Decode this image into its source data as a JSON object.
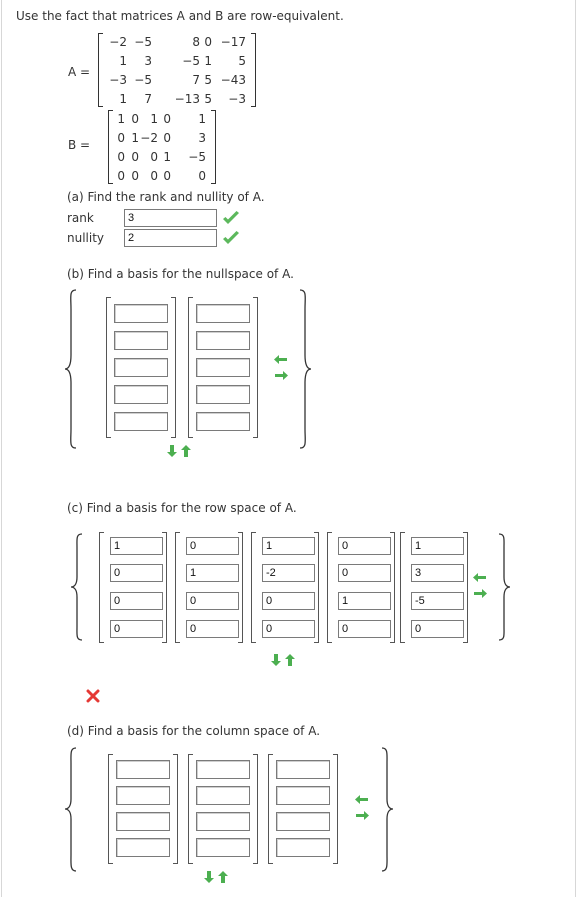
{
  "prompt": "Use the fact that matrices A and B are row-equivalent.",
  "matrixA": {
    "label": "A =",
    "rows": [
      [
        "−2",
        "−5",
        "8",
        "0",
        "−17"
      ],
      [
        "1",
        "3",
        "−5",
        "1",
        "5"
      ],
      [
        "−3",
        "−5",
        "7",
        "5",
        "−43"
      ],
      [
        "1",
        "7",
        "−13",
        "5",
        "−3"
      ]
    ]
  },
  "matrixB": {
    "label": "B =",
    "rows": [
      [
        "1",
        "0",
        "1",
        "0",
        "1"
      ],
      [
        "0",
        "1",
        "−2",
        "0",
        "3"
      ],
      [
        "0",
        "0",
        "0",
        "1",
        "−5"
      ],
      [
        "0",
        "0",
        "0",
        "0",
        "0"
      ]
    ]
  },
  "partA": {
    "title": "(a) Find the rank and nullity of A.",
    "rank_label": "rank",
    "rank_value": "3",
    "nullity_label": "nullity",
    "nullity_value": "2",
    "status_color": "#5cb85c"
  },
  "partB": {
    "title": "(b) Find a basis for the nullspace of A."
  },
  "partC": {
    "title": "(c) Find a basis for the row space of A.",
    "vectors": [
      [
        "1",
        "0",
        "0",
        "0"
      ],
      [
        "0",
        "1",
        "0",
        "0"
      ],
      [
        "1",
        "-2",
        "0",
        "0"
      ],
      [
        "0",
        "0",
        "1",
        "0"
      ],
      [
        "1",
        "3",
        "-5",
        "0"
      ]
    ],
    "status_color": "#e53935"
  },
  "partD": {
    "title": "(d) Find a basis for the column space of A."
  },
  "icons": {
    "arrow_color": "#4caf50",
    "add_remove_column": "add-remove-column-icon",
    "add_remove_row": "add-remove-row-icon"
  }
}
